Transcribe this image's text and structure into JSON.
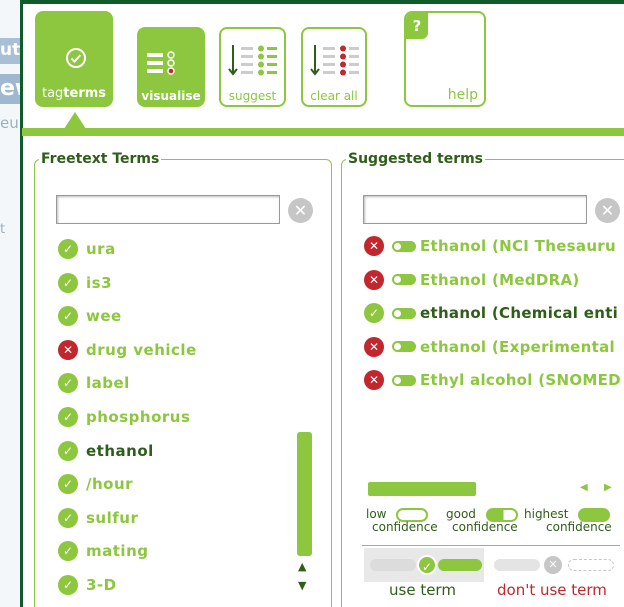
{
  "background_app": {
    "tab1_text": "uti",
    "tab2_text": "ew",
    "side_text": "euk",
    "tick_text": "t"
  },
  "toolbar": {
    "tagterms_prefix": "tag",
    "tagterms_bold": "terms",
    "visualise_label": "visualise",
    "suggest_label": "suggest",
    "clear_all_label": "clear all",
    "help_label": "help",
    "help_glyph": "?"
  },
  "freetext": {
    "legend": "Freetext Terms",
    "input_value": "",
    "clear_icon": "⊗",
    "terms": [
      {
        "label": "ura",
        "status": "ok",
        "selected": false
      },
      {
        "label": "is3",
        "status": "ok",
        "selected": false
      },
      {
        "label": "wee",
        "status": "ok",
        "selected": false
      },
      {
        "label": "drug vehicle",
        "status": "reject",
        "selected": false
      },
      {
        "label": "label",
        "status": "ok",
        "selected": false
      },
      {
        "label": "phosphorus",
        "status": "ok",
        "selected": false
      },
      {
        "label": "ethanol",
        "status": "ok",
        "selected": true
      },
      {
        "label": "/hour",
        "status": "ok",
        "selected": false
      },
      {
        "label": "sulfur",
        "status": "ok",
        "selected": false
      },
      {
        "label": "mating",
        "status": "ok",
        "selected": false
      },
      {
        "label": "3-D",
        "status": "ok",
        "selected": false
      }
    ]
  },
  "suggested": {
    "legend": "Suggested terms",
    "input_value": "",
    "terms": [
      {
        "label": "Ethanol (NCI Thesauru",
        "status": "reject",
        "selected": false
      },
      {
        "label": "Ethanol (MedDRA)",
        "status": "reject",
        "selected": false
      },
      {
        "label": "ethanol (Chemical enti",
        "status": "ok",
        "selected": true
      },
      {
        "label": "ethanol (Experimental",
        "status": "reject",
        "selected": false
      },
      {
        "label": "Ethyl alcohol (SNOMED",
        "status": "reject",
        "selected": false
      }
    ],
    "legend_low": "low",
    "legend_low_2": "confidence",
    "legend_good": "good",
    "legend_good_2": "confidence",
    "legend_high": "highest",
    "legend_high_2": "confidence",
    "use_term_label": "use term",
    "dont_use_term_label": "don't use term"
  },
  "colors": {
    "accent": "#8dc63f",
    "dark_green": "#2f5d1a",
    "frame": "#0f5c2a",
    "reject": "#c1272d",
    "dont_use": "#c1272d",
    "use": "#2f5d1a"
  }
}
